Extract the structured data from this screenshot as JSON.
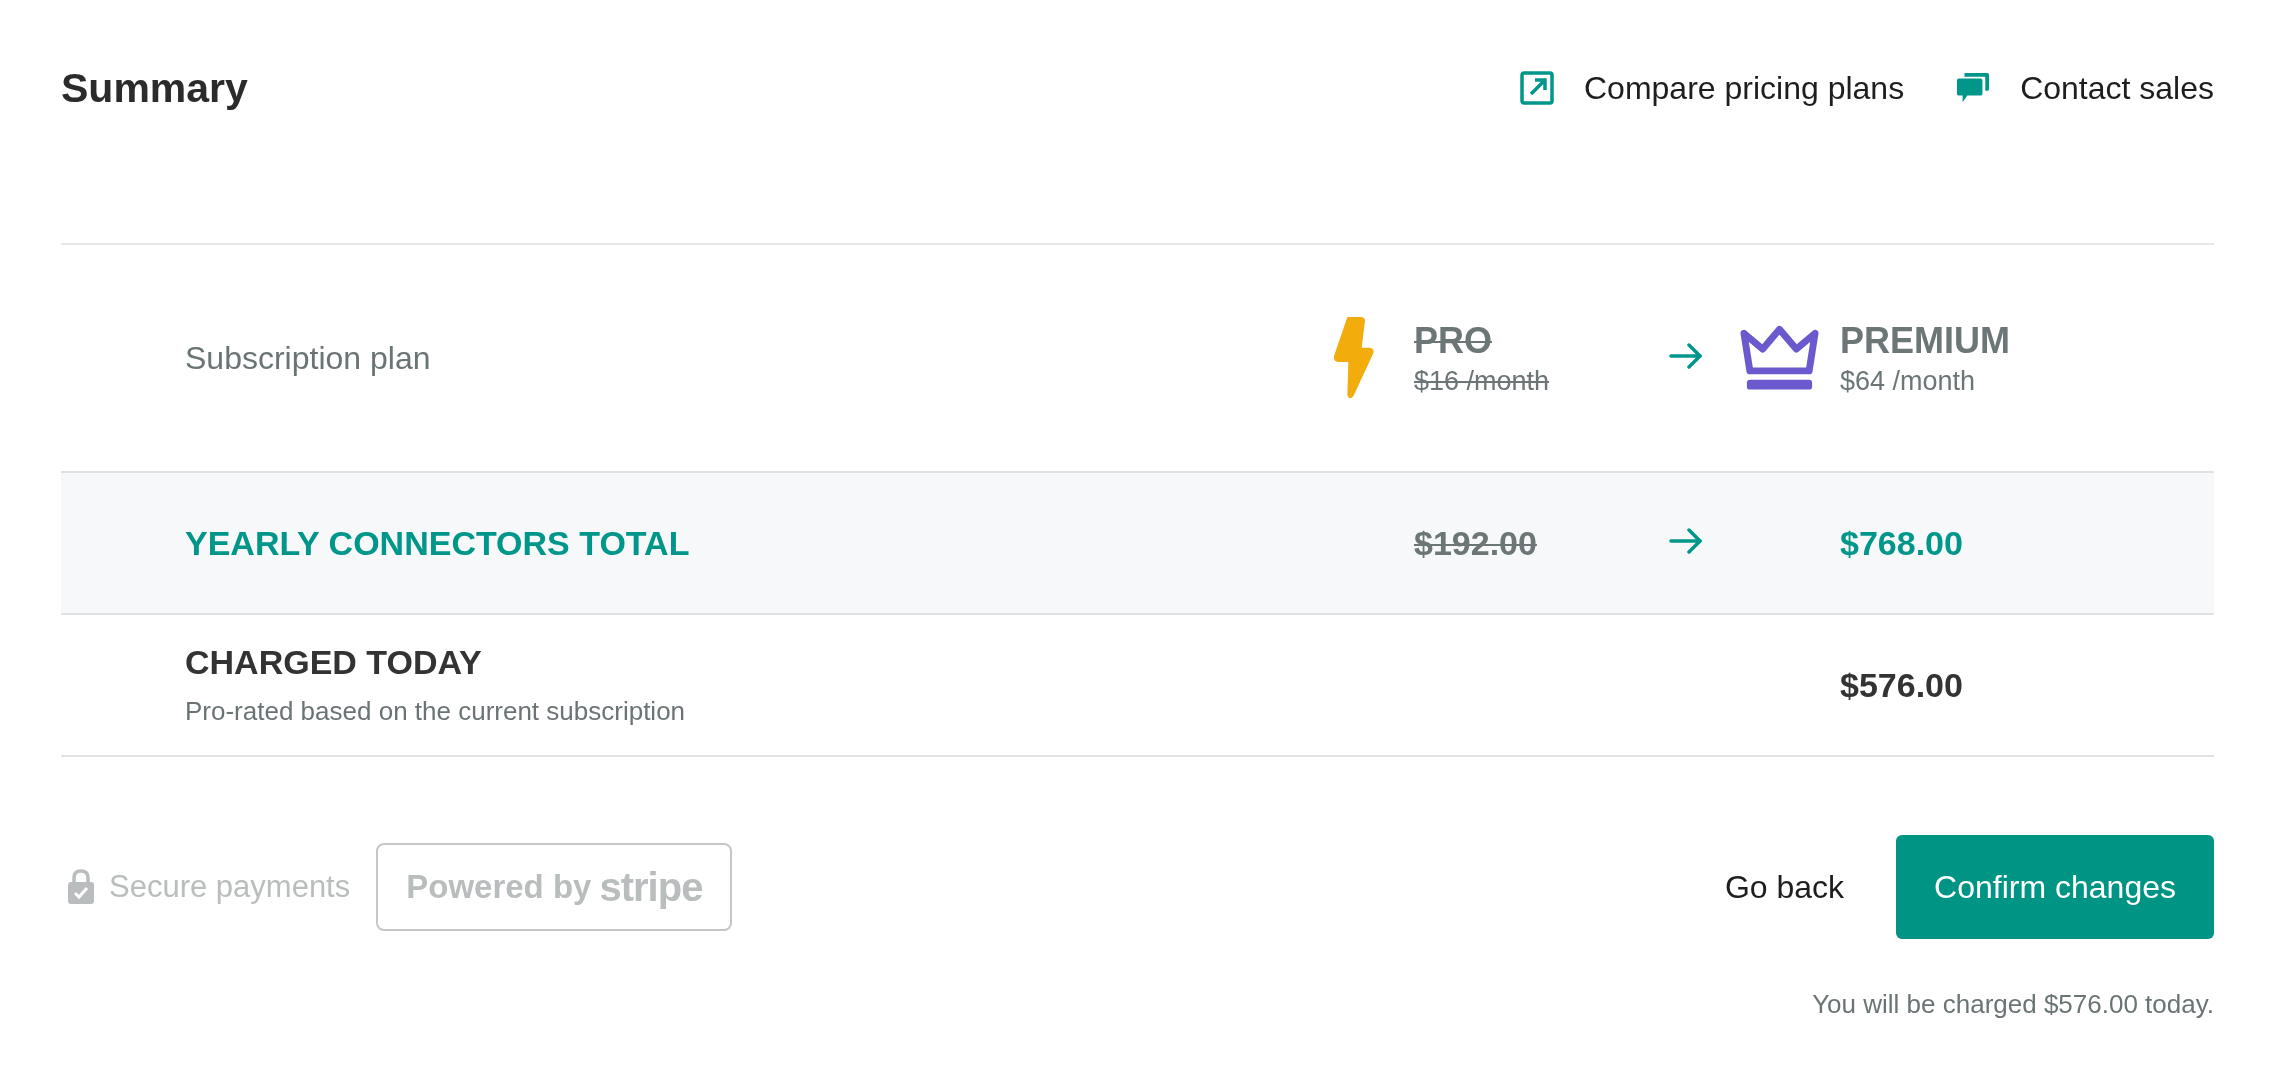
{
  "header": {
    "title": "Summary",
    "links": [
      {
        "label": "Compare pricing plans",
        "kind": "external"
      },
      {
        "label": "Contact sales",
        "kind": "chat"
      }
    ]
  },
  "plan_row": {
    "label": "Subscription plan",
    "from": {
      "name": "PRO",
      "price": "$16 /month",
      "kind": "bolt"
    },
    "to": {
      "name": "PREMIUM",
      "price": "$64 /month",
      "kind": "crown"
    }
  },
  "total_row": {
    "label": "YEARLY CONNECTORS TOTAL",
    "from": "$192.00",
    "to": "$768.00"
  },
  "charged_row": {
    "label": "CHARGED TODAY",
    "note": "Pro-rated based on the current subscription",
    "amount": "$576.00"
  },
  "footer": {
    "secure": "Secure payments",
    "powered_by": "Powered by",
    "brand": "stripe",
    "buttons": [
      {
        "label": "Go back",
        "kind": "text"
      },
      {
        "label": "Confirm changes",
        "kind": "primary"
      }
    ],
    "note": "You will be charged $576.00 today."
  }
}
